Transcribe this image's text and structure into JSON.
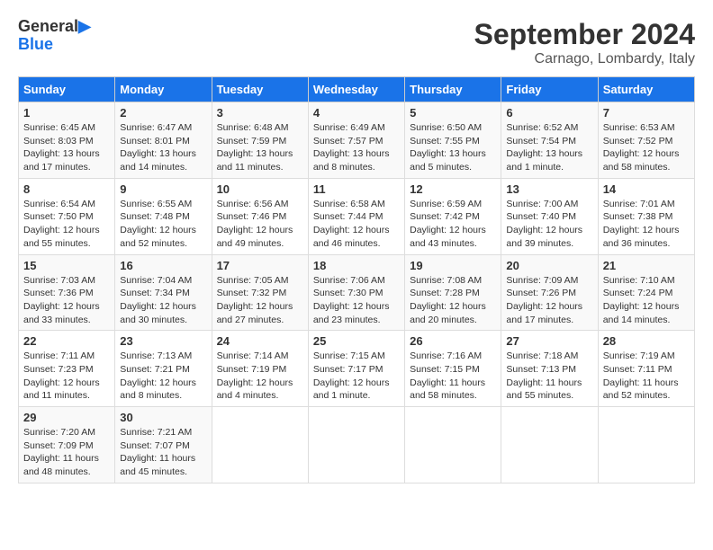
{
  "logo": {
    "line1": "General",
    "line2": "Blue"
  },
  "title": "September 2024",
  "location": "Carnago, Lombardy, Italy",
  "headers": [
    "Sunday",
    "Monday",
    "Tuesday",
    "Wednesday",
    "Thursday",
    "Friday",
    "Saturday"
  ],
  "weeks": [
    [
      {
        "day": "1",
        "sunrise": "6:45 AM",
        "sunset": "8:03 PM",
        "daylight": "13 hours and 17 minutes."
      },
      {
        "day": "2",
        "sunrise": "6:47 AM",
        "sunset": "8:01 PM",
        "daylight": "13 hours and 14 minutes."
      },
      {
        "day": "3",
        "sunrise": "6:48 AM",
        "sunset": "7:59 PM",
        "daylight": "13 hours and 11 minutes."
      },
      {
        "day": "4",
        "sunrise": "6:49 AM",
        "sunset": "7:57 PM",
        "daylight": "13 hours and 8 minutes."
      },
      {
        "day": "5",
        "sunrise": "6:50 AM",
        "sunset": "7:55 PM",
        "daylight": "13 hours and 5 minutes."
      },
      {
        "day": "6",
        "sunrise": "6:52 AM",
        "sunset": "7:54 PM",
        "daylight": "13 hours and 1 minute."
      },
      {
        "day": "7",
        "sunrise": "6:53 AM",
        "sunset": "7:52 PM",
        "daylight": "12 hours and 58 minutes."
      }
    ],
    [
      {
        "day": "8",
        "sunrise": "6:54 AM",
        "sunset": "7:50 PM",
        "daylight": "12 hours and 55 minutes."
      },
      {
        "day": "9",
        "sunrise": "6:55 AM",
        "sunset": "7:48 PM",
        "daylight": "12 hours and 52 minutes."
      },
      {
        "day": "10",
        "sunrise": "6:56 AM",
        "sunset": "7:46 PM",
        "daylight": "12 hours and 49 minutes."
      },
      {
        "day": "11",
        "sunrise": "6:58 AM",
        "sunset": "7:44 PM",
        "daylight": "12 hours and 46 minutes."
      },
      {
        "day": "12",
        "sunrise": "6:59 AM",
        "sunset": "7:42 PM",
        "daylight": "12 hours and 43 minutes."
      },
      {
        "day": "13",
        "sunrise": "7:00 AM",
        "sunset": "7:40 PM",
        "daylight": "12 hours and 39 minutes."
      },
      {
        "day": "14",
        "sunrise": "7:01 AM",
        "sunset": "7:38 PM",
        "daylight": "12 hours and 36 minutes."
      }
    ],
    [
      {
        "day": "15",
        "sunrise": "7:03 AM",
        "sunset": "7:36 PM",
        "daylight": "12 hours and 33 minutes."
      },
      {
        "day": "16",
        "sunrise": "7:04 AM",
        "sunset": "7:34 PM",
        "daylight": "12 hours and 30 minutes."
      },
      {
        "day": "17",
        "sunrise": "7:05 AM",
        "sunset": "7:32 PM",
        "daylight": "12 hours and 27 minutes."
      },
      {
        "day": "18",
        "sunrise": "7:06 AM",
        "sunset": "7:30 PM",
        "daylight": "12 hours and 23 minutes."
      },
      {
        "day": "19",
        "sunrise": "7:08 AM",
        "sunset": "7:28 PM",
        "daylight": "12 hours and 20 minutes."
      },
      {
        "day": "20",
        "sunrise": "7:09 AM",
        "sunset": "7:26 PM",
        "daylight": "12 hours and 17 minutes."
      },
      {
        "day": "21",
        "sunrise": "7:10 AM",
        "sunset": "7:24 PM",
        "daylight": "12 hours and 14 minutes."
      }
    ],
    [
      {
        "day": "22",
        "sunrise": "7:11 AM",
        "sunset": "7:23 PM",
        "daylight": "12 hours and 11 minutes."
      },
      {
        "day": "23",
        "sunrise": "7:13 AM",
        "sunset": "7:21 PM",
        "daylight": "12 hours and 8 minutes."
      },
      {
        "day": "24",
        "sunrise": "7:14 AM",
        "sunset": "7:19 PM",
        "daylight": "12 hours and 4 minutes."
      },
      {
        "day": "25",
        "sunrise": "7:15 AM",
        "sunset": "7:17 PM",
        "daylight": "12 hours and 1 minute."
      },
      {
        "day": "26",
        "sunrise": "7:16 AM",
        "sunset": "7:15 PM",
        "daylight": "11 hours and 58 minutes."
      },
      {
        "day": "27",
        "sunrise": "7:18 AM",
        "sunset": "7:13 PM",
        "daylight": "11 hours and 55 minutes."
      },
      {
        "day": "28",
        "sunrise": "7:19 AM",
        "sunset": "7:11 PM",
        "daylight": "11 hours and 52 minutes."
      }
    ],
    [
      {
        "day": "29",
        "sunrise": "7:20 AM",
        "sunset": "7:09 PM",
        "daylight": "11 hours and 48 minutes."
      },
      {
        "day": "30",
        "sunrise": "7:21 AM",
        "sunset": "7:07 PM",
        "daylight": "11 hours and 45 minutes."
      },
      null,
      null,
      null,
      null,
      null
    ]
  ],
  "labels": {
    "sunrise": "Sunrise:",
    "sunset": "Sunset:",
    "daylight": "Daylight:"
  }
}
